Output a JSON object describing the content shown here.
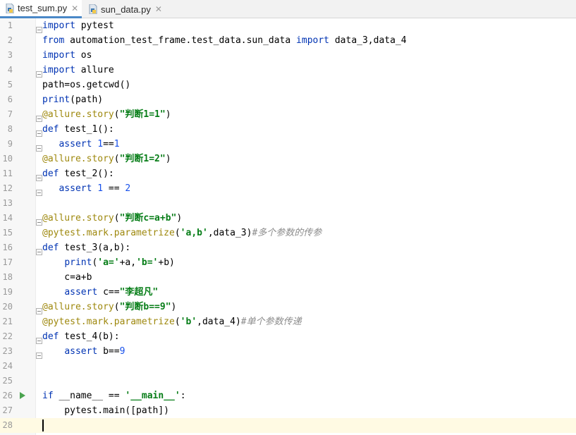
{
  "tabs": [
    {
      "label": "test_sum.py",
      "close": "✕",
      "active": true
    },
    {
      "label": "sun_data.py",
      "close": "✕",
      "active": false
    }
  ],
  "editor": {
    "current_line": 28,
    "lines": [
      {
        "n": "1",
        "tokens": [
          {
            "t": "kw",
            "v": "import"
          },
          {
            "t": "",
            "v": " pytest"
          }
        ]
      },
      {
        "n": "2",
        "tokens": [
          {
            "t": "kw",
            "v": "from"
          },
          {
            "t": "",
            "v": " automation_test_frame.test_data.sun_data "
          },
          {
            "t": "kw",
            "v": "import"
          },
          {
            "t": "",
            "v": " data_3,data_4"
          }
        ]
      },
      {
        "n": "3",
        "tokens": [
          {
            "t": "kw",
            "v": "import"
          },
          {
            "t": "",
            "v": " os"
          }
        ]
      },
      {
        "n": "4",
        "tokens": [
          {
            "t": "kw",
            "v": "import"
          },
          {
            "t": "",
            "v": " allure"
          }
        ]
      },
      {
        "n": "5",
        "tokens": [
          {
            "t": "",
            "v": "path=os.getcwd()"
          }
        ]
      },
      {
        "n": "6",
        "tokens": [
          {
            "t": "kw",
            "v": "print"
          },
          {
            "t": "",
            "v": "(path)"
          }
        ]
      },
      {
        "n": "7",
        "tokens": [
          {
            "t": "dec",
            "v": "@allure.story"
          },
          {
            "t": "",
            "v": "("
          },
          {
            "t": "str",
            "v": "\"判断1=1\""
          },
          {
            "t": "",
            "v": ")"
          }
        ]
      },
      {
        "n": "8",
        "tokens": [
          {
            "t": "kw",
            "v": "def"
          },
          {
            "t": "",
            "v": " test_1():"
          }
        ]
      },
      {
        "n": "9",
        "tokens": [
          {
            "t": "",
            "v": "   "
          },
          {
            "t": "kw",
            "v": "assert"
          },
          {
            "t": "",
            "v": " "
          },
          {
            "t": "num",
            "v": "1"
          },
          {
            "t": "",
            "v": "=="
          },
          {
            "t": "num",
            "v": "1"
          }
        ]
      },
      {
        "n": "10",
        "tokens": [
          {
            "t": "dec",
            "v": "@allure.story"
          },
          {
            "t": "",
            "v": "("
          },
          {
            "t": "str",
            "v": "\"判断1=2\""
          },
          {
            "t": "",
            "v": ")"
          }
        ]
      },
      {
        "n": "11",
        "tokens": [
          {
            "t": "kw",
            "v": "def"
          },
          {
            "t": "",
            "v": " test_2():"
          }
        ]
      },
      {
        "n": "12",
        "tokens": [
          {
            "t": "",
            "v": "   "
          },
          {
            "t": "kw",
            "v": "assert"
          },
          {
            "t": "",
            "v": " "
          },
          {
            "t": "num",
            "v": "1"
          },
          {
            "t": "",
            "v": " == "
          },
          {
            "t": "num",
            "v": "2"
          }
        ]
      },
      {
        "n": "13",
        "tokens": []
      },
      {
        "n": "14",
        "tokens": [
          {
            "t": "dec",
            "v": "@allure.story"
          },
          {
            "t": "",
            "v": "("
          },
          {
            "t": "str",
            "v": "\"判断c=a+b\""
          },
          {
            "t": "",
            "v": ")"
          }
        ]
      },
      {
        "n": "15",
        "tokens": [
          {
            "t": "dec",
            "v": "@pytest.mark.parametrize"
          },
          {
            "t": "",
            "v": "("
          },
          {
            "t": "str",
            "v": "'a,b'"
          },
          {
            "t": "",
            "v": ",data_3)"
          },
          {
            "t": "cmt",
            "v": "#多个参数的传参"
          }
        ]
      },
      {
        "n": "16",
        "tokens": [
          {
            "t": "kw",
            "v": "def"
          },
          {
            "t": "",
            "v": " test_3(a,b):"
          }
        ]
      },
      {
        "n": "17",
        "tokens": [
          {
            "t": "",
            "v": "    "
          },
          {
            "t": "kw",
            "v": "print"
          },
          {
            "t": "",
            "v": "("
          },
          {
            "t": "str",
            "v": "'a='"
          },
          {
            "t": "",
            "v": "+a,"
          },
          {
            "t": "str",
            "v": "'b='"
          },
          {
            "t": "",
            "v": "+b)"
          }
        ]
      },
      {
        "n": "18",
        "tokens": [
          {
            "t": "",
            "v": "    c=a+b"
          }
        ]
      },
      {
        "n": "19",
        "tokens": [
          {
            "t": "",
            "v": "    "
          },
          {
            "t": "kw",
            "v": "assert"
          },
          {
            "t": "",
            "v": " c=="
          },
          {
            "t": "str",
            "v": "\"李超凡\""
          }
        ]
      },
      {
        "n": "20",
        "tokens": [
          {
            "t": "dec",
            "v": "@allure.story"
          },
          {
            "t": "",
            "v": "("
          },
          {
            "t": "str",
            "v": "\"判断b==9\""
          },
          {
            "t": "",
            "v": ")"
          }
        ]
      },
      {
        "n": "21",
        "tokens": [
          {
            "t": "dec",
            "v": "@pytest.mark.parametrize"
          },
          {
            "t": "",
            "v": "("
          },
          {
            "t": "str",
            "v": "'b'"
          },
          {
            "t": "",
            "v": ",data_4)"
          },
          {
            "t": "cmt",
            "v": "#单个参数传递"
          }
        ]
      },
      {
        "n": "22",
        "tokens": [
          {
            "t": "kw",
            "v": "def"
          },
          {
            "t": "",
            "v": " test_4(b):"
          }
        ]
      },
      {
        "n": "23",
        "tokens": [
          {
            "t": "",
            "v": "    "
          },
          {
            "t": "kw",
            "v": "assert"
          },
          {
            "t": "",
            "v": " b=="
          },
          {
            "t": "num",
            "v": "9"
          }
        ]
      },
      {
        "n": "24",
        "tokens": []
      },
      {
        "n": "25",
        "tokens": []
      },
      {
        "n": "26",
        "run": true,
        "tokens": [
          {
            "t": "kw",
            "v": "if"
          },
          {
            "t": "",
            "v": " __name__ == "
          },
          {
            "t": "str",
            "v": "'__main__'"
          },
          {
            "t": "",
            "v": ":"
          }
        ]
      },
      {
        "n": "27",
        "tokens": [
          {
            "t": "",
            "v": "    pytest.main([path])"
          }
        ]
      },
      {
        "n": "28",
        "tokens": []
      }
    ],
    "fold_lines": [
      1,
      4,
      7,
      8,
      9,
      11,
      12,
      14,
      16,
      20,
      22,
      23
    ]
  }
}
